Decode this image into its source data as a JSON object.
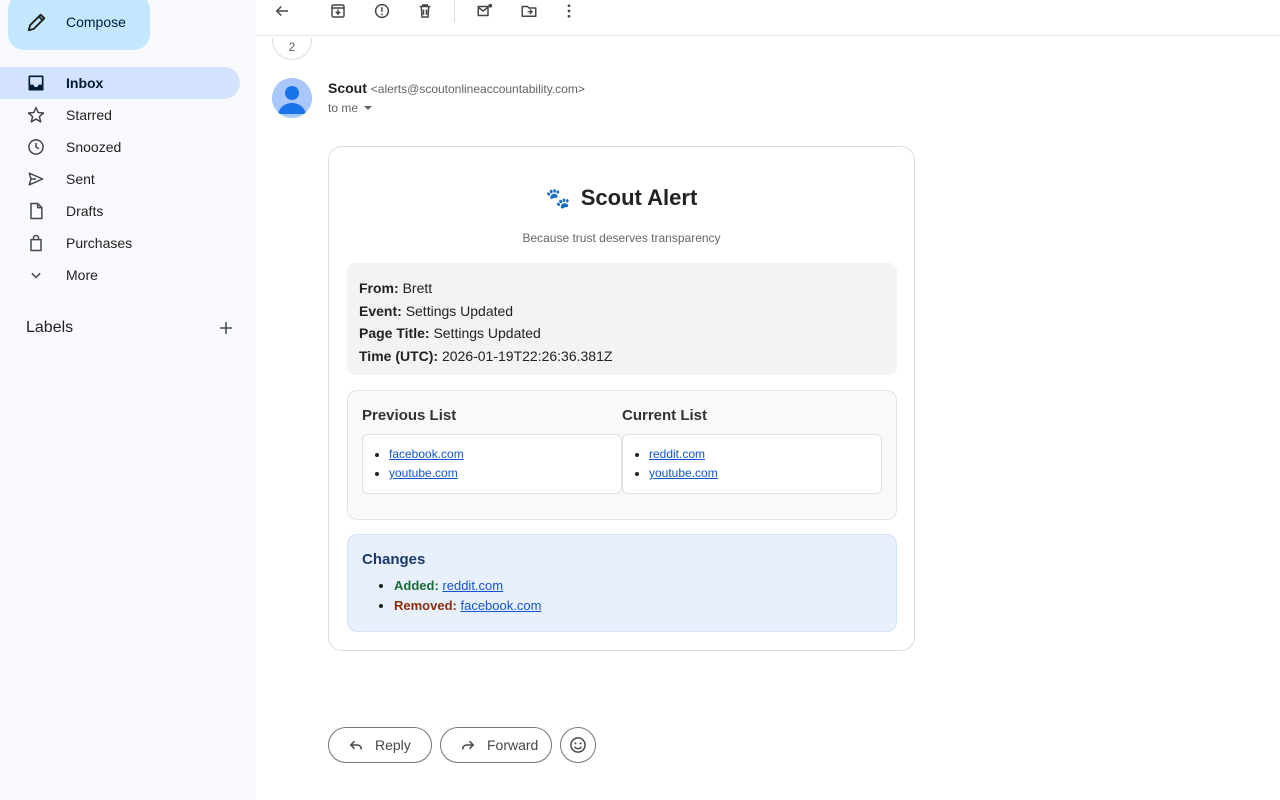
{
  "sidebar": {
    "compose_label": "Compose",
    "items": [
      {
        "label": "Inbox",
        "icon": "inbox-icon",
        "active": true
      },
      {
        "label": "Starred",
        "icon": "star-icon"
      },
      {
        "label": "Snoozed",
        "icon": "clock-icon"
      },
      {
        "label": "Sent",
        "icon": "send-icon"
      },
      {
        "label": "Drafts",
        "icon": "draft-icon"
      },
      {
        "label": "Purchases",
        "icon": "shopping-bag-icon"
      },
      {
        "label": "More",
        "icon": "chevron-down-icon"
      }
    ],
    "labels_heading": "Labels"
  },
  "toolbar": {
    "icons": [
      "back-arrow-icon",
      "archive-icon",
      "report-spam-icon",
      "delete-icon",
      "mark-unread-icon",
      "move-to-icon",
      "more-vert-icon"
    ]
  },
  "thread": {
    "collapsed_count": "2"
  },
  "message": {
    "sender_name": "Scout",
    "sender_email": "<alerts@scoutonlineaccountability.com>",
    "recipient": "to me"
  },
  "email": {
    "title": "Scout Alert",
    "title_emoji": "🐾",
    "tagline": "Because trust deserves transparency",
    "info": {
      "from_label": "From:",
      "from_value": "Brett",
      "event_label": "Event:",
      "event_value": "Settings Updated",
      "page_title_label": "Page Title:",
      "page_title_value": "Settings Updated",
      "time_label": "Time (UTC):",
      "time_value": "2026-01-19T22:26:36.381Z"
    },
    "previous_list": {
      "heading": "Previous List",
      "items": [
        "facebook.com",
        "youtube.com"
      ]
    },
    "current_list": {
      "heading": "Current List",
      "items": [
        "reddit.com",
        "youtube.com"
      ]
    },
    "changes": {
      "heading": "Changes",
      "added_label": "Added:",
      "added_value": "reddit.com",
      "removed_label": "Removed:",
      "removed_value": "facebook.com"
    }
  },
  "actions": {
    "reply_label": "Reply",
    "forward_label": "Forward"
  },
  "colors": {
    "compose_bg": "#c2e7ff",
    "active_nav_bg": "#d3e3fd",
    "link": "#1155cc",
    "added": "#1e6b34",
    "removed": "#8a2e0a"
  }
}
